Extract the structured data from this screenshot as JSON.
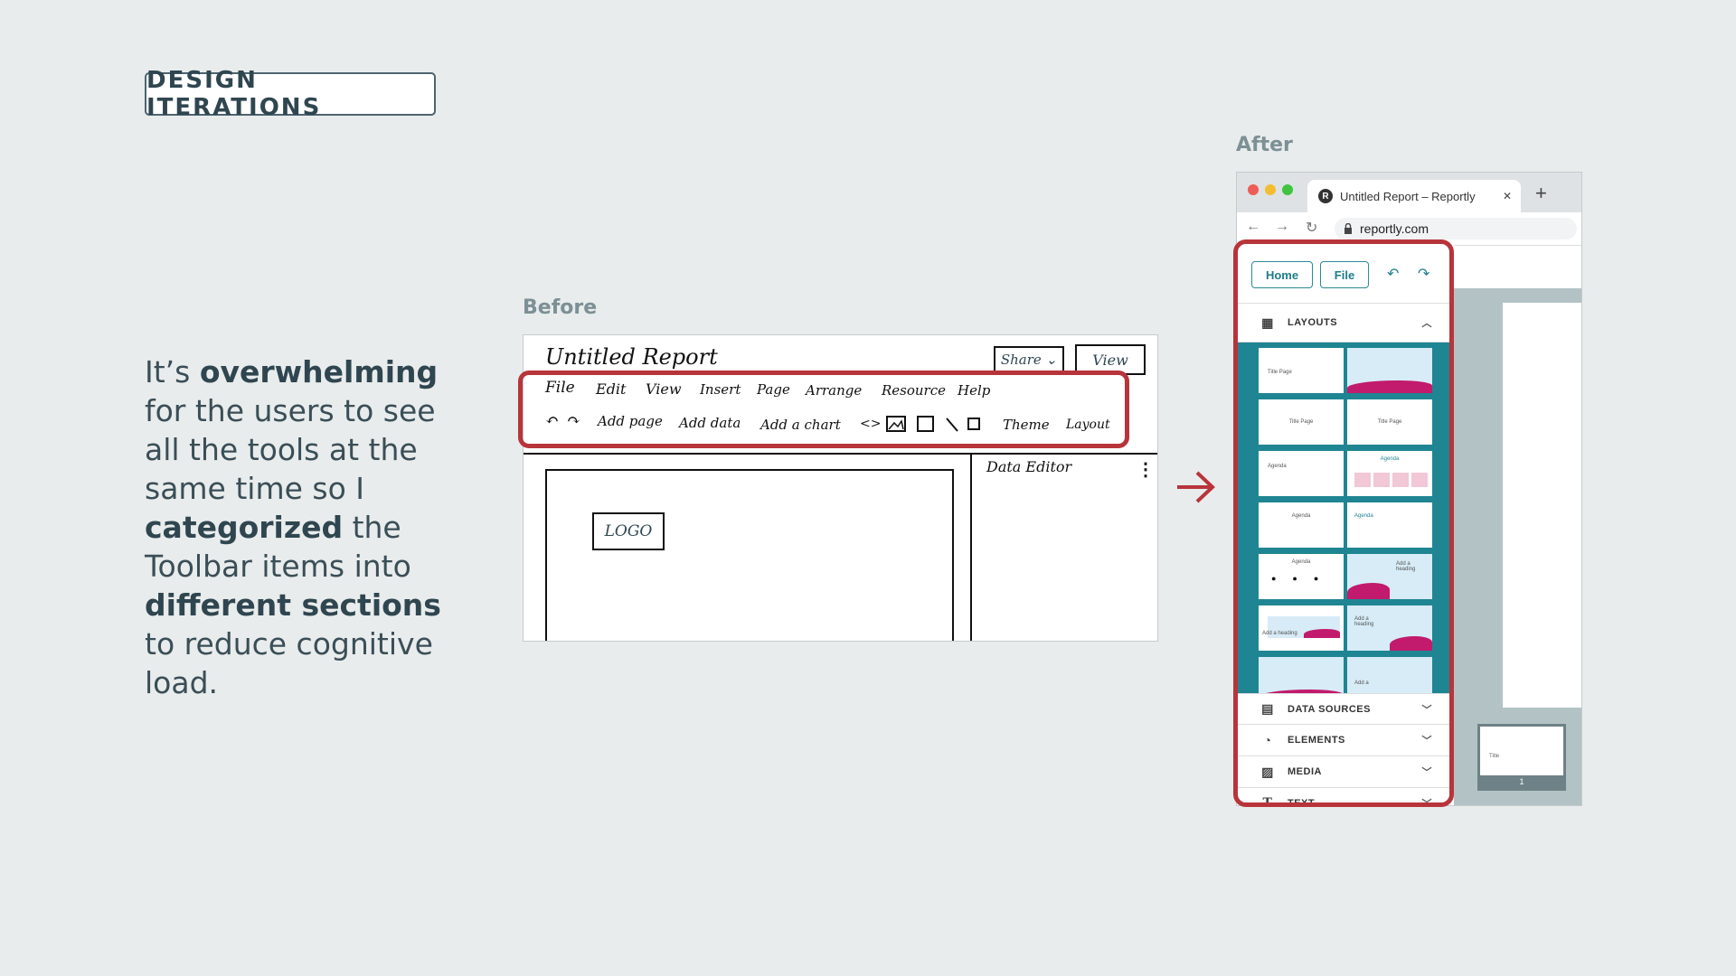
{
  "heading": "DESIGN ITERATIONS",
  "description": {
    "p1": "It’s ",
    "b1": "overwhelming",
    "p2": " for the users to see all the tools at the same time so I ",
    "b2": "categorized",
    "p3": " the Toolbar items into ",
    "b3": "different sections",
    "p4": " to reduce cognitive load."
  },
  "before": {
    "label": "Before",
    "title": "Untitled Report",
    "share": "Share ⌄",
    "view": "View",
    "menu": [
      "File",
      "Edit",
      "View",
      "Insert",
      "Page",
      "Arrange",
      "Resource",
      "Help"
    ],
    "tools": [
      "↶",
      "↷",
      "Add page",
      "Add data",
      "Add a chart",
      "<>",
      "Theme",
      "Layout"
    ],
    "logo": "LOGO",
    "data_editor": "Data Editor",
    "more": "⋮"
  },
  "after": {
    "label": "After",
    "tab_icon": "R",
    "tab_title": "Untitled Report – Reportly",
    "tab_close": "✕",
    "new_tab": "+",
    "url": "reportly.com",
    "home_btn": "Home",
    "file_btn": "File",
    "undo": "↶",
    "redo": "↷",
    "layouts_label": "LAYOUTS",
    "thumbs": [
      "Title Page",
      "Title Page",
      "Title Page",
      "Agenda",
      "Agenda",
      "Agenda",
      "Agenda",
      "Agenda",
      "Add a heading",
      "Add a heading",
      "Add a heading",
      "Add a"
    ],
    "sections": [
      "DATA SOURCES",
      "ELEMENTS",
      "MEDIA",
      "TEXT"
    ],
    "page_number": "1",
    "mini_title": "Title"
  },
  "colors": {
    "accent": "#1f8592",
    "highlight": "#b8343b",
    "brand_pink": "#c21a6c"
  },
  "icons": [
    "arrow-right-icon",
    "layouts-icon",
    "data-sources-icon",
    "elements-icon",
    "media-icon",
    "text-icon",
    "lock-icon",
    "chevron-icon"
  ]
}
